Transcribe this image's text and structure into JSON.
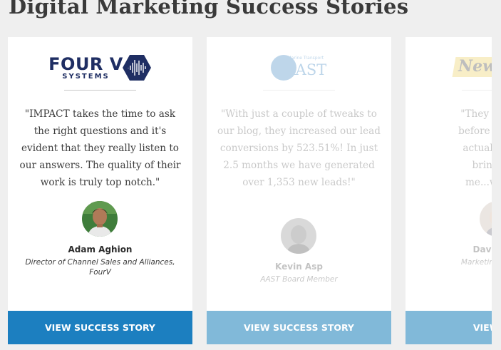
{
  "page": {
    "title": "Digital Marketing Success Stories"
  },
  "colors": {
    "cta_active": "#1c7fc0",
    "cta_faded": "#81b9d9",
    "fourv_navy": "#1f2e63"
  },
  "cards": [
    {
      "logo": {
        "icon": "fourv-systems-logo",
        "text": "FOUR V",
        "sub": "SYSTEMS"
      },
      "quote": "\"IMPACT takes the time to ask the right questions and it's evident that they really listen to our answers. The quality of their work is truly top notch.\"",
      "person": {
        "name": "Adam Aghion",
        "role": "Director of Channel Sales and Alliances, FourV"
      },
      "cta": "VIEW SUCCESS STORY"
    },
    {
      "logo": {
        "icon": "aast-logo",
        "text": "AAST",
        "small": "Marine Transport"
      },
      "quote": "\"With just a couple of tweaks to our blog, they increased our lead conversions by 523.51%! In just 2.5 months we have generated over 1,353 new leads!\"",
      "person": {
        "name": "Kevin Asp",
        "role": "AAST Board Member"
      },
      "cta": "VIEW SUCCESS STORY"
    },
    {
      "logo": {
        "icon": "news-logo",
        "text": "News"
      },
      "quote_lines": [
        "\"They did a fan",
        "before we finish",
        "actually sold s",
        "bringing n",
        "me...which w"
      ],
      "person": {
        "name": "David Mec",
        "role": "Marketing Strategis"
      },
      "cta": "VIEW SUC"
    }
  ]
}
